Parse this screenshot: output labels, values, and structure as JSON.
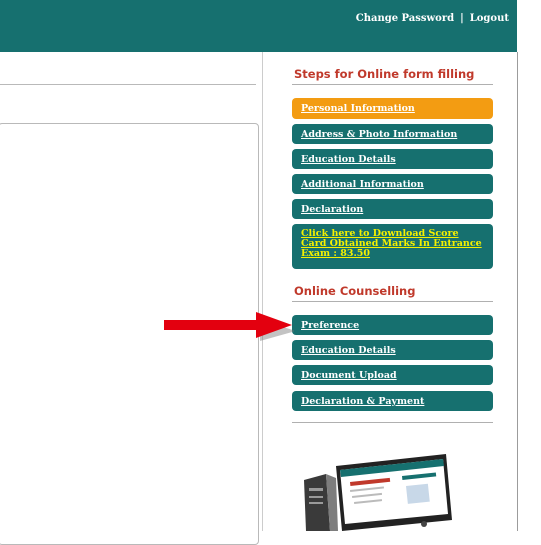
{
  "header": {
    "change_password": "Change Password",
    "separator": "|",
    "logout": "Logout"
  },
  "steps": {
    "title": "Steps for Online form filling",
    "items": [
      {
        "label": "Personal Information",
        "active": true
      },
      {
        "label": "Address & Photo Information"
      },
      {
        "label": "Education Details"
      },
      {
        "label": "Additional Information"
      },
      {
        "label": "Declaration"
      }
    ],
    "score_card": "Click here to Download Score Card Obtained Marks In Entrance Exam : 83.50"
  },
  "counselling": {
    "title": "Online Counselling",
    "items": [
      {
        "label": "Preference"
      },
      {
        "label": "Education Details"
      },
      {
        "label": "Document Upload"
      },
      {
        "label": "Declaration & Payment"
      }
    ]
  },
  "colors": {
    "primary": "#16706f",
    "active": "#f39c12",
    "heading": "#c0392b",
    "highlight_text": "#f4f000",
    "arrow": "#e3000f"
  },
  "icons": {
    "arrow": "red-arrow-icon",
    "illustration": "computer-illustration"
  }
}
